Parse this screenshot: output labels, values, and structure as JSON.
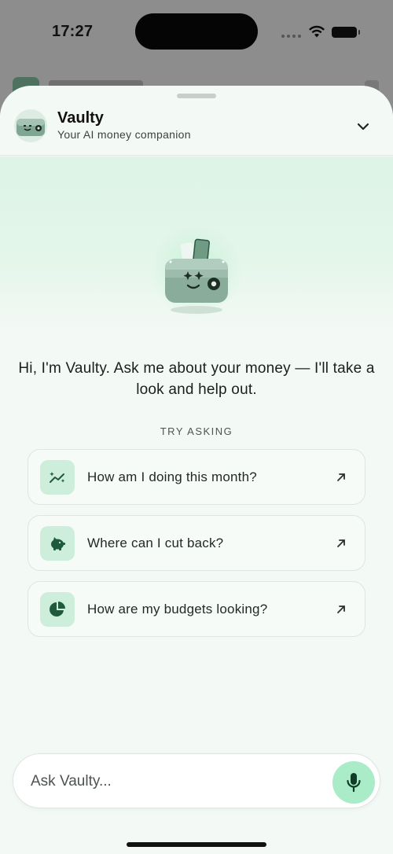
{
  "status_bar": {
    "time": "17:27"
  },
  "header": {
    "title": "Vaulty",
    "subtitle": "Your AI money companion"
  },
  "intro": {
    "text": "Hi, I'm Vaulty. Ask me about your money — I'll take a look and help out."
  },
  "suggestions": {
    "label": "TRY ASKING",
    "items": [
      {
        "text": "How am I doing this month?",
        "icon": "trend-sparkle-icon"
      },
      {
        "text": "Where can I cut back?",
        "icon": "piggy-bank-icon"
      },
      {
        "text": "How are my budgets looking?",
        "icon": "pie-chart-icon"
      }
    ]
  },
  "composer": {
    "placeholder": "Ask Vaulty..."
  },
  "colors": {
    "accent": "#a9ecc7",
    "icon_bg": "#cdeedb",
    "icon_fg": "#1f5a3c",
    "sheet_bg": "#f3f9f5"
  }
}
